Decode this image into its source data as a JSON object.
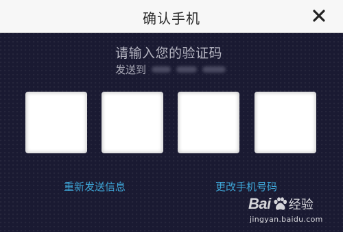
{
  "header": {
    "title": "确认手机",
    "close_icon": "close-icon"
  },
  "prompt": {
    "title": "请输入您的验证码",
    "sent_to_label": "发送到"
  },
  "code_inputs": [
    {
      "value": ""
    },
    {
      "value": ""
    },
    {
      "value": ""
    },
    {
      "value": ""
    }
  ],
  "actions": {
    "resend_label": "重新发送信息",
    "change_phone_label": "更改手机号码"
  },
  "watermark": {
    "logo_text_left": "Bai",
    "logo_text_right": "经验",
    "url": "jingyan.baidu.com",
    "logo_icon": "baidu-paw-icon"
  },
  "colors": {
    "background": "#1a1a32",
    "header_bg": "#f7f7f7",
    "link": "#3ea5d6",
    "prompt_text": "#b8b8c4"
  }
}
